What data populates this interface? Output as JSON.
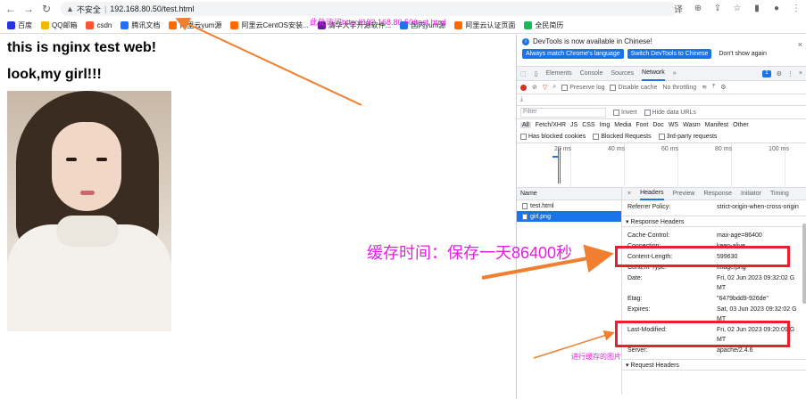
{
  "browser": {
    "security_label": "不安全",
    "url": "192.168.80.50/test.html"
  },
  "bookmarks": [
    {
      "label": "百度",
      "color": "#2932e1"
    },
    {
      "label": "QQ邮箱",
      "color": "#f2b705"
    },
    {
      "label": "csdn",
      "color": "#fc5531"
    },
    {
      "label": "腾讯文档",
      "color": "#1e6fff"
    },
    {
      "label": "阿里云yum源",
      "color": "#ff6a00"
    },
    {
      "label": "阿里云CentOS安装...",
      "color": "#ff6a00"
    },
    {
      "label": "清华大学开源软件...",
      "color": "#6a1b9a"
    },
    {
      "label": "国内yum源",
      "color": "#1a73e8"
    },
    {
      "label": "阿里云认证页面",
      "color": "#ff6a00"
    },
    {
      "label": "全民简历",
      "color": "#19b955"
    }
  ],
  "page": {
    "heading1": "this is nginx test web!",
    "heading2": "look,my girl!!!"
  },
  "annotations": {
    "note_url": "此处访问http://192.168.80.50/test.html",
    "note_cache": "缓存时间：保存一天86400秒",
    "note_image": "进行缓存的图片",
    "color": "#e020e0",
    "highlight_color": "#e8222c",
    "arrow_color": "#f08030"
  },
  "devtools": {
    "banner_text": "DevTools is now available in Chinese!",
    "btn_match": "Always match Chrome's language",
    "btn_switch": "Switch DevTools to Chinese",
    "btn_dont_show": "Don't show again",
    "tabs": [
      "Elements",
      "Console",
      "Sources",
      "Network"
    ],
    "more_tabs": "»",
    "message_count": "1",
    "preserve_log": "Preserve log",
    "disable_cache": "Disable cache",
    "throttle": "No throttling",
    "filter_placeholder": "Filter",
    "invert": "Invert",
    "hide_data_urls": "Hide data URLs",
    "types": [
      "All",
      "Fetch/XHR",
      "JS",
      "CSS",
      "Img",
      "Media",
      "Font",
      "Doc",
      "WS",
      "Wasm",
      "Manifest",
      "Other"
    ],
    "blocked_cookies": "Has blocked cookies",
    "blocked_requests": "Blocked Requests",
    "third_party": "3rd-party requests",
    "timeline_ticks": [
      "20 ms",
      "40 ms",
      "60 ms",
      "80 ms",
      "100 ms"
    ],
    "name_header": "Name",
    "requests": [
      "test.html",
      "girl.png"
    ],
    "detail_tabs": [
      "×",
      "Headers",
      "Preview",
      "Response",
      "Initiator",
      "Timing"
    ],
    "referrer_key": "Referrer Policy:",
    "referrer_value": "strict-origin-when-cross-origin",
    "response_headers_title": "▾ Response Headers",
    "request_headers_title": "▾ Request Headers",
    "headers": [
      {
        "k": "Cache-Control:",
        "v": "max-age=86400"
      },
      {
        "k": "Connection:",
        "v": "keep-alive"
      },
      {
        "k": "Content-Length:",
        "v": "599630"
      },
      {
        "k": "Content-Type:",
        "v": "image/png"
      },
      {
        "k": "Date:",
        "v": "Fri, 02 Jun 2023 09:32:02 GMT"
      },
      {
        "k": "Etag:",
        "v": "\"6479bdd9-926de\""
      },
      {
        "k": "Expires:",
        "v": "Sat, 03 Jun 2023 09:32:02 GMT"
      },
      {
        "k": "Last-Modified:",
        "v": "Fri, 02 Jun 2023 09:20:09 GMT"
      },
      {
        "k": "Server:",
        "v": "apache/2.4.6"
      }
    ]
  }
}
